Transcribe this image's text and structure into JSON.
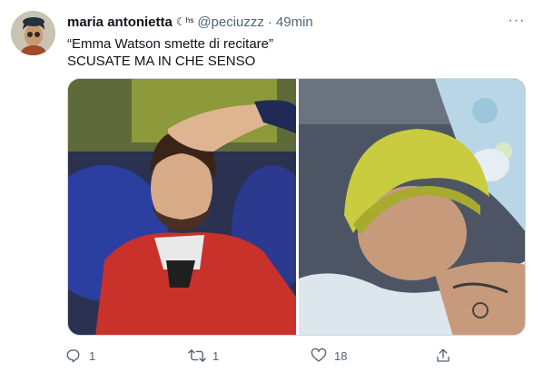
{
  "tweet": {
    "author_name": "maria antonietta",
    "author_badge": "☾ʰˢ",
    "handle": "@peciuzzz",
    "separator": "·",
    "time": "49min",
    "text_line1": "“Emma Watson smette di recitare”",
    "text_line2": "SCUSATE MA IN CHE SENSO",
    "more_label": "···"
  },
  "actions": {
    "reply_count": "1",
    "retweet_count": "1",
    "like_count": "18"
  },
  "icons": {
    "reply": "reply-icon",
    "retweet": "retweet-icon",
    "like": "heart-icon",
    "share": "share-icon",
    "more": "more-icon"
  },
  "colors": {
    "text_primary": "#0f1419",
    "text_secondary": "#536471",
    "border": "#cfd9de"
  }
}
